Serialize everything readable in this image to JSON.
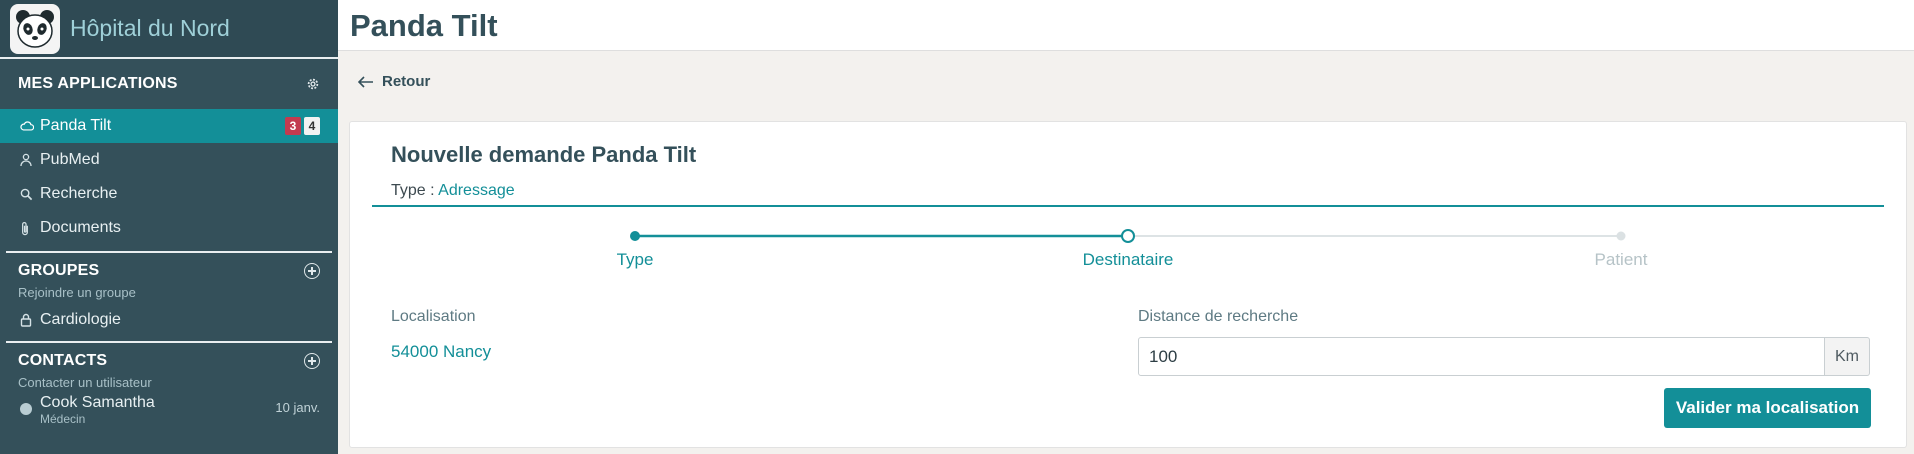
{
  "brand": {
    "name": "Hôpital du Nord",
    "logo_icon": "panda-icon"
  },
  "sidebar": {
    "apps_title": "MES APPLICATIONS",
    "apps": [
      {
        "label": "Panda Tilt",
        "icon": "cloud-icon",
        "active": true,
        "badge_red": "3",
        "badge_white": "4"
      },
      {
        "label": "PubMed",
        "icon": "pubmed-icon"
      },
      {
        "label": "Recherche",
        "icon": "search-icon"
      },
      {
        "label": "Documents",
        "icon": "paperclip-icon"
      }
    ],
    "groups_title": "GROUPES",
    "groups_sub": "Rejoindre un groupe",
    "groups": [
      {
        "label": "Cardiologie",
        "icon": "lock-icon"
      }
    ],
    "contacts_title": "CONTACTS",
    "contacts_sub": "Contacter un utilisateur",
    "contacts": [
      {
        "name": "Cook Samantha",
        "role": "Médecin",
        "date": "10 janv."
      }
    ]
  },
  "header": {
    "title": "Panda Tilt"
  },
  "back": {
    "label": "Retour"
  },
  "form": {
    "title": "Nouvelle demande Panda Tilt",
    "type_label": "Type :",
    "type_value": "Adressage",
    "steps": [
      {
        "label": "Type",
        "state": "done"
      },
      {
        "label": "Destinataire",
        "state": "current"
      },
      {
        "label": "Patient",
        "state": "todo"
      }
    ],
    "location_label": "Localisation",
    "location_value": "54000 Nancy",
    "distance_label": "Distance de recherche",
    "distance_value": "100",
    "distance_unit": "Km",
    "submit_label": "Valider ma localisation"
  },
  "colors": {
    "accent": "#138f98",
    "sidebar": "#34505a",
    "badge_red": "#c33a4f"
  }
}
